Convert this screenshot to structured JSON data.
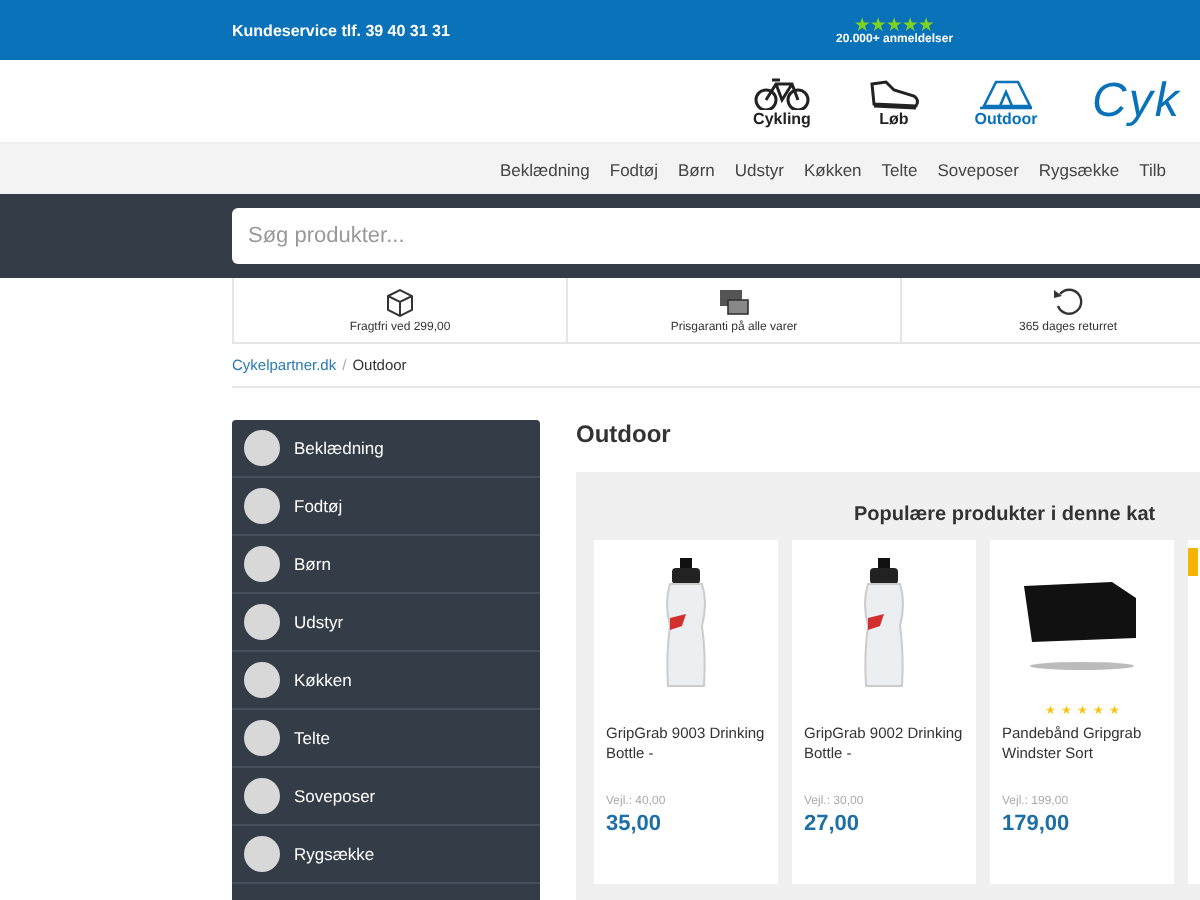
{
  "top_bar": {
    "phone": "Kundeservice tlf. 39 40 31 31",
    "stars": 5,
    "reviews": "20.000+ anmeldelser"
  },
  "nav": [
    {
      "label": "Cykling",
      "selected": false
    },
    {
      "label": "Løb",
      "selected": false
    },
    {
      "label": "Outdoor",
      "selected": true
    }
  ],
  "logo": "Cyk",
  "categories": [
    "Beklædning",
    "Fodtøj",
    "Børn",
    "Udstyr",
    "Køkken",
    "Telte",
    "Soveposer",
    "Rygsække",
    "Tilb"
  ],
  "search": {
    "placeholder": "Søg produkter..."
  },
  "features": [
    "Fragtfri ved 299,00",
    "Prisgaranti på alle varer",
    "365 dages returret"
  ],
  "breadcrumb": {
    "items": [
      "Cykelpartner.dk",
      "Outdoor"
    ],
    "separator": "/"
  },
  "sidebar": {
    "items": [
      "Beklædning",
      "Fodtøj",
      "Børn",
      "Udstyr",
      "Køkken",
      "Telte",
      "Soveposer",
      "Rygsække"
    ]
  },
  "page_title": "Outdoor",
  "popular": {
    "heading": "Populære produkter i denne kat",
    "products": [
      {
        "kind": "bottle",
        "name": "GripGrab 9003 Drinking Bottle -",
        "list_price": "Vejl.: 40,00",
        "price": "35,00"
      },
      {
        "kind": "bottle",
        "name": "GripGrab 9002 Drinking Bottle -",
        "list_price": "Vejl.: 30,00",
        "price": "27,00"
      },
      {
        "kind": "headband",
        "name": "Pandebånd Gripgrab Windster Sort",
        "stars": 5,
        "list_price": "Vejl.: 199,00",
        "price": "179,00"
      }
    ]
  }
}
